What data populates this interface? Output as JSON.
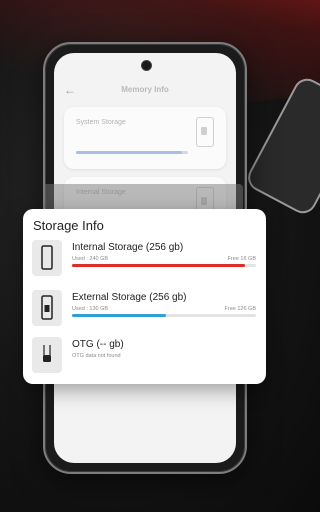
{
  "background_screen": {
    "title": "Memory Info",
    "cards": [
      {
        "title": "System Storage",
        "subtitle": "",
        "progress": 0.95
      },
      {
        "title": "Internal Storage",
        "subtitle": "",
        "progress": 0
      }
    ]
  },
  "popup": {
    "title": "Storage Info",
    "items": [
      {
        "name": "Internal Storage (256 gb)",
        "used": "Used : 240 GB",
        "free": "Free 16 GB",
        "progress": 0.94,
        "icon": "phone-icon",
        "color": "#e12b26"
      },
      {
        "name": "External Storage (256 gb)",
        "used": "Used : 130 GB",
        "free": "Free 126 GB",
        "progress": 0.51,
        "icon": "sd-card-icon",
        "color": "#2f9fd8"
      },
      {
        "name": "OTG (-- gb)",
        "used": "OTG data not found",
        "free": "",
        "progress": null,
        "icon": "usb-otg-icon",
        "color": ""
      }
    ]
  },
  "colors": {
    "accent_red": "#e12b26",
    "accent_blue": "#2f9fd8"
  }
}
